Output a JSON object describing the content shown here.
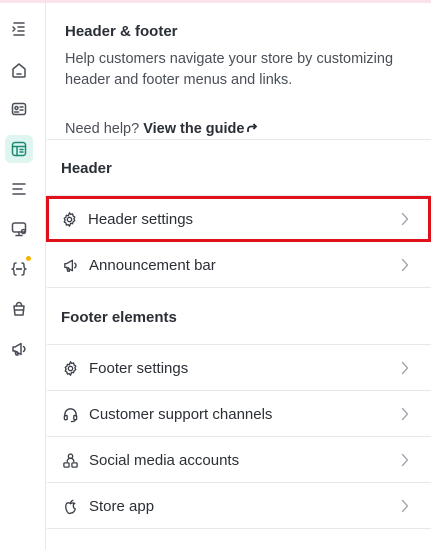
{
  "rail": {
    "items": [
      {
        "name": "collapse-menu-icon",
        "active": false,
        "dot": false
      },
      {
        "name": "home-icon",
        "active": false,
        "dot": false
      },
      {
        "name": "id-card-icon",
        "active": false,
        "dot": false
      },
      {
        "name": "layout-icon",
        "active": true,
        "dot": false
      },
      {
        "name": "list-icon",
        "active": false,
        "dot": false
      },
      {
        "name": "monitor-icon",
        "active": false,
        "dot": false
      },
      {
        "name": "code-braces-icon",
        "active": false,
        "dot": true
      },
      {
        "name": "bag-icon",
        "active": false,
        "dot": false
      },
      {
        "name": "megaphone-icon",
        "active": false,
        "dot": false
      }
    ],
    "accent": "#1a8a74",
    "dot_color": "#f5b400"
  },
  "intro": {
    "title": "Header & footer",
    "description": "Help customers navigate your store by customizing header and footer menus and links.",
    "help_prefix": "Need help?",
    "help_link": "View the guide"
  },
  "header_section": {
    "title": "Header",
    "items": [
      {
        "label": "Header settings",
        "icon": "gear-icon",
        "highlighted": true
      },
      {
        "label": "Announcement bar",
        "icon": "megaphone-icon",
        "highlighted": false
      }
    ]
  },
  "footer_section": {
    "title": "Footer elements",
    "items": [
      {
        "label": "Footer settings",
        "icon": "gear-icon"
      },
      {
        "label": "Customer support channels",
        "icon": "headset-icon"
      },
      {
        "label": "Social media accounts",
        "icon": "people-icon"
      },
      {
        "label": "Store app",
        "icon": "apple-icon"
      }
    ]
  },
  "highlight_color": "#e0111b"
}
